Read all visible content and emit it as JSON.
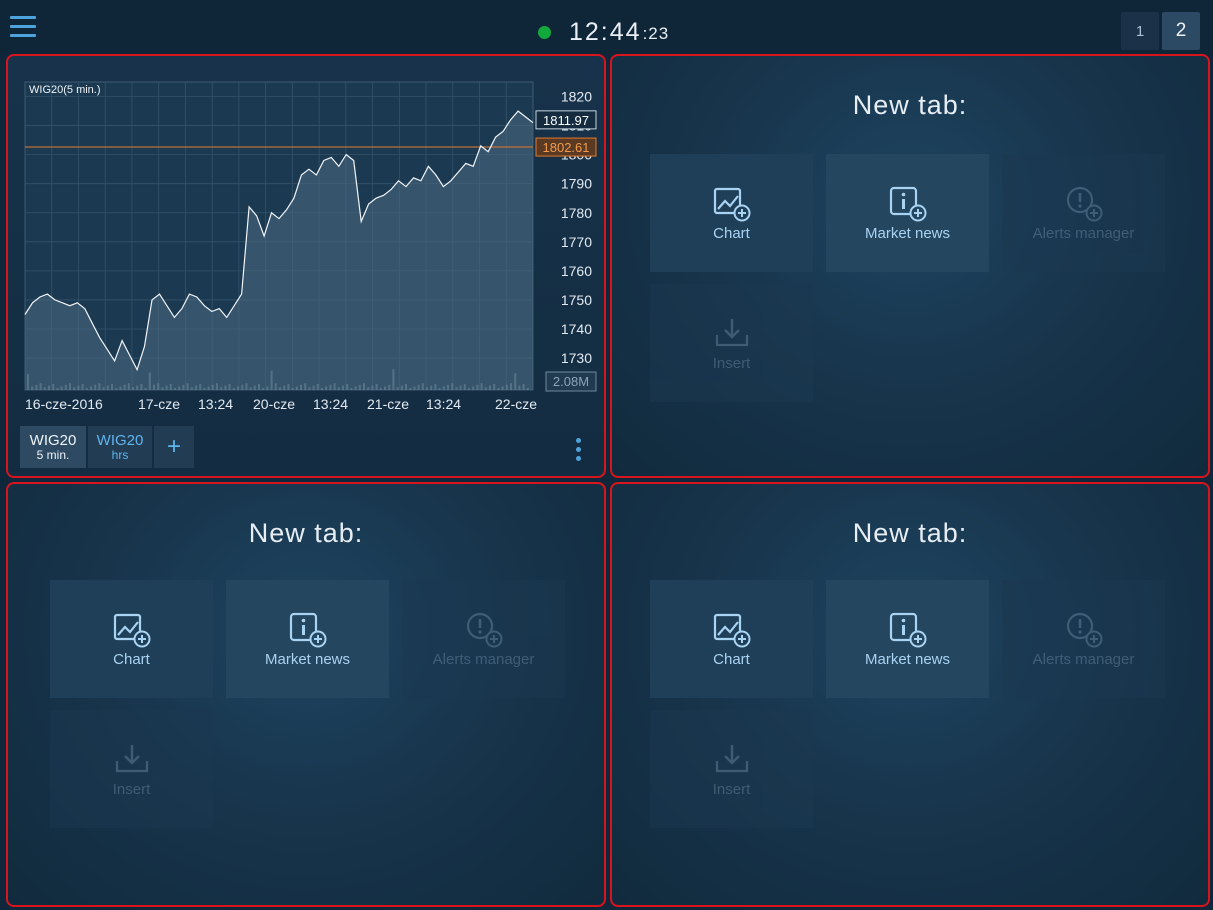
{
  "clock": {
    "main": "12:44",
    "seconds": ":23",
    "status_color": "#13a83c"
  },
  "workspaces": [
    "1",
    "2"
  ],
  "workspaces_active": "2",
  "colors": {
    "accent": "#4fa3dd",
    "panel_border": "#d8141d",
    "last_price": "#ffffff",
    "ref_line": "#e8792a"
  },
  "chart_panel": {
    "tabs": [
      {
        "symbol": "WIG20",
        "interval": "5 min.",
        "active": true
      },
      {
        "symbol": "WIG20",
        "interval": "hrs",
        "active": false
      }
    ],
    "add_label": "+"
  },
  "chart_data": {
    "type": "line",
    "title": "WIG20(5 min.)",
    "x_tick_labels": [
      "16-cze-2016",
      "17-cze",
      "13:24",
      "20-cze",
      "13:24",
      "21-cze",
      "13:24",
      "22-cze"
    ],
    "y_ticks": [
      1730,
      1740,
      1750,
      1760,
      1770,
      1780,
      1790,
      1800,
      1810,
      1820
    ],
    "ylim": [
      1719,
      1825
    ],
    "last_price_label": "1811.97",
    "reference_line_label": "1802.61",
    "volume_label": "2.08M",
    "series": [
      {
        "values": [
          1745,
          1749,
          1751,
          1752,
          1750,
          1749,
          1748,
          1749,
          1747,
          1742,
          1737,
          1733,
          1729,
          1736,
          1731,
          1726,
          1734,
          1750,
          1752,
          1748,
          1744,
          1747,
          1752,
          1751,
          1748,
          1746,
          1747,
          1744,
          1748,
          1752,
          1782,
          1779,
          1772,
          1780,
          1778,
          1781,
          1785,
          1793,
          1795,
          1793,
          1798,
          1799,
          1796,
          1800,
          1798,
          1777,
          1783,
          1785,
          1786,
          1788,
          1791,
          1789,
          1792,
          1791,
          1796,
          1793,
          1789,
          1791,
          1794,
          1797,
          1796,
          1803,
          1801,
          1806,
          1808,
          1812,
          1815,
          1813,
          1811
        ]
      }
    ],
    "grid": true
  },
  "new_tab_panels": [
    {
      "title": "New tab:",
      "tiles": [
        {
          "label": "Chart",
          "icon": "chart-add-icon",
          "enabled": true
        },
        {
          "label": "Market news",
          "icon": "info-add-icon",
          "enabled": true
        },
        {
          "label": "Alerts manager",
          "icon": "alert-add-icon",
          "enabled": false
        },
        {
          "label": "Insert",
          "icon": "insert-icon",
          "enabled": false
        }
      ]
    },
    {
      "title": "New tab:",
      "tiles": [
        {
          "label": "Chart",
          "icon": "chart-add-icon",
          "enabled": true
        },
        {
          "label": "Market news",
          "icon": "info-add-icon",
          "enabled": true
        },
        {
          "label": "Alerts manager",
          "icon": "alert-add-icon",
          "enabled": false
        },
        {
          "label": "Insert",
          "icon": "insert-icon",
          "enabled": false
        }
      ]
    },
    {
      "title": "New tab:",
      "tiles": [
        {
          "label": "Chart",
          "icon": "chart-add-icon",
          "enabled": true
        },
        {
          "label": "Market news",
          "icon": "info-add-icon",
          "enabled": true
        },
        {
          "label": "Alerts manager",
          "icon": "alert-add-icon",
          "enabled": false
        },
        {
          "label": "Insert",
          "icon": "insert-icon",
          "enabled": false
        }
      ]
    }
  ]
}
